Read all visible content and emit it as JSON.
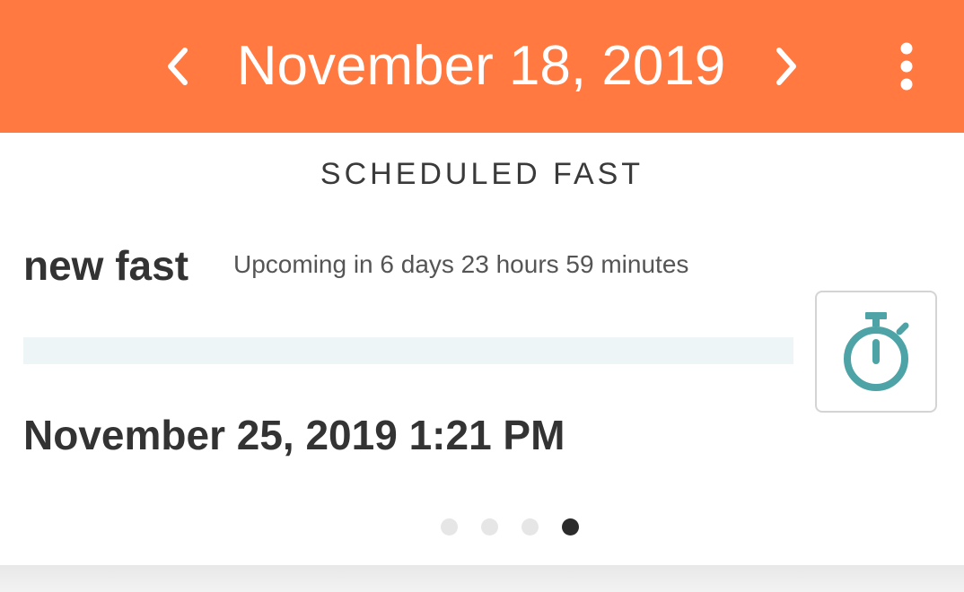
{
  "header": {
    "date": "November 18, 2019",
    "prev_icon": "chevron-left-icon",
    "next_icon": "chevron-right-icon",
    "menu_icon": "more-vertical-icon",
    "background_color": "#ff7940"
  },
  "card": {
    "section_title": "SCHEDULED FAST",
    "fast_name": "new fast",
    "status": "Upcoming in 6 days 23 hours 59 minutes",
    "progress": 0,
    "datetime": "November 25, 2019 1:21 PM",
    "timer_icon": "stopwatch-icon",
    "accent_color": "#4da3a5"
  },
  "pager": {
    "total": 4,
    "active_index": 3
  }
}
